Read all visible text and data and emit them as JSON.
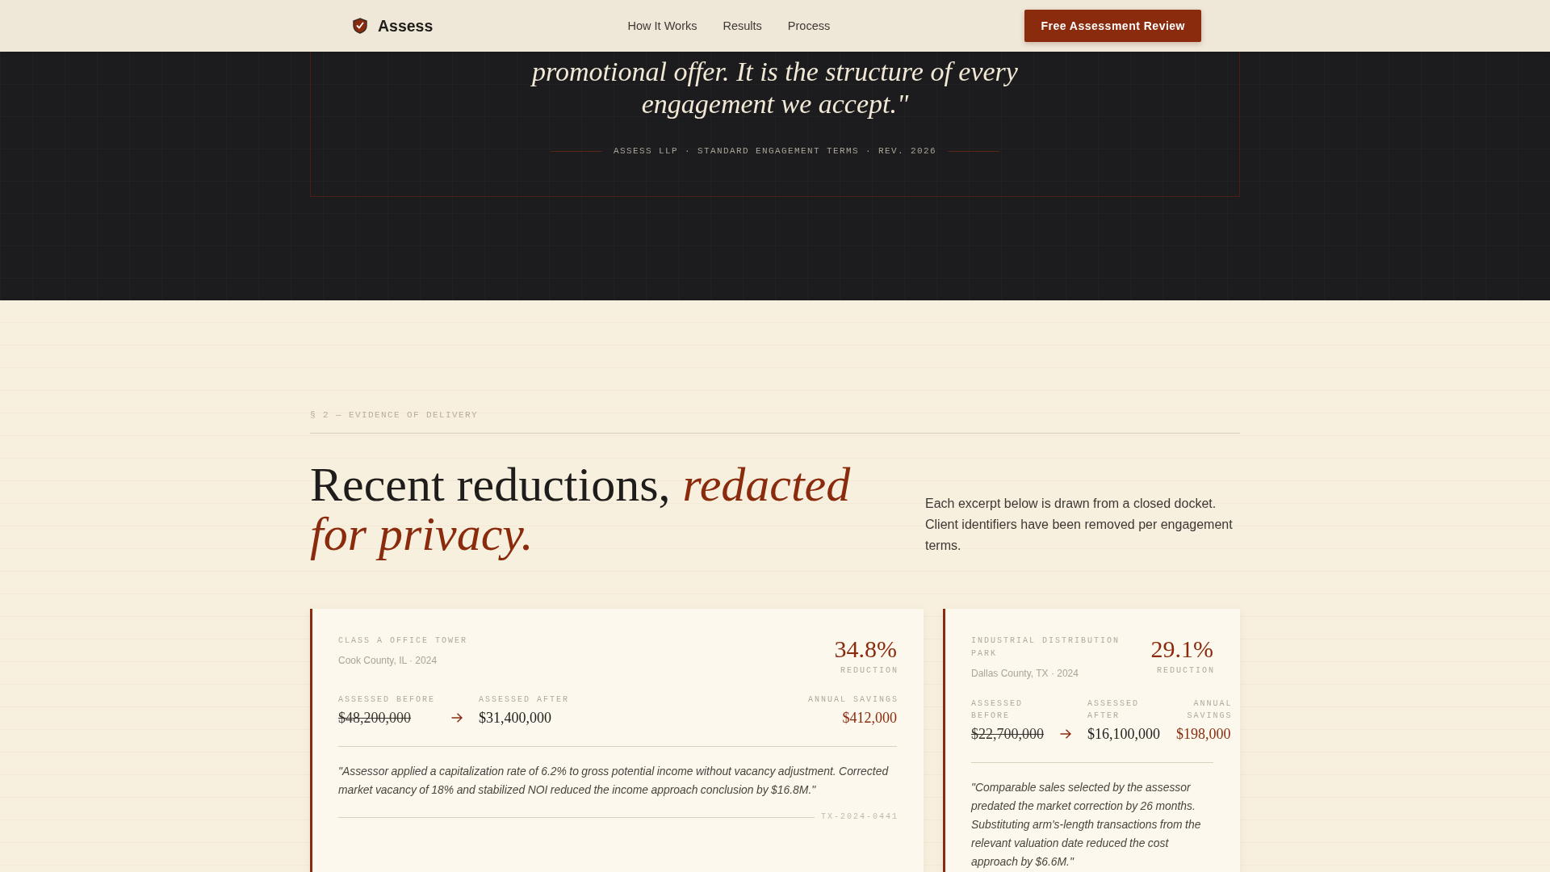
{
  "nav": {
    "brand": "Assess",
    "links": [
      "How It Works",
      "Results",
      "Process"
    ],
    "cta": "Free Assessment Review"
  },
  "commitment": {
    "quote": "promotional offer. It is the structure of every engagement we accept.\"",
    "attribution": "ASSESS LLP · STANDARD ENGAGEMENT TERMS · REV. 2026"
  },
  "evidence": {
    "eyebrow": "§ 2 — EVIDENCE OF DELIVERY",
    "heading": "Recent reductions, *redacted for privacy.*",
    "intro": "Each excerpt below is drawn from a closed docket. Client identifiers have been removed per engagement terms.",
    "cases": [
      {
        "property_type": "CLASS A OFFICE TOWER",
        "location": "Cook County, IL · 2024",
        "reduction": "34.8%",
        "reduction_label": "REDUCTION",
        "metrics": [
          {
            "kind": "before",
            "label": "ASSESSED BEFORE",
            "value": "$48,200,000"
          },
          {
            "kind": "after",
            "label": "ASSESSED AFTER",
            "value": "$31,400,000"
          },
          {
            "kind": "savings",
            "label": "ANNUAL SAVINGS",
            "value": "$412,000"
          }
        ],
        "summary": "\"Assessor applied a capitalization rate of 6.2% to gross potential income without vacancy adjustment. Corrected market vacancy of 18% and stabilized NOI reduced the income approach conclusion by $16.8M.\"",
        "docket": "TX-2024-0441"
      },
      {
        "property_type": "INDUSTRIAL DISTRIBUTION PARK",
        "location": "Dallas County, TX · 2024",
        "reduction": "29.1%",
        "reduction_label": "REDUCTION",
        "metrics": [
          {
            "kind": "before",
            "label": "ASSESSED BEFORE",
            "value": "$22,700,000"
          },
          {
            "kind": "after",
            "label": "ASSESSED AFTER",
            "value": "$16,100,000"
          },
          {
            "kind": "savings",
            "label": "ANNUAL SAVINGS",
            "value": "$198,000"
          }
        ],
        "summary": "\"Comparable sales selected by the assessor predated the market correction by 26 months. Substituting arm's-length transactions from the relevant valuation date reduced the cost approach by $6.6M.\""
      }
    ]
  }
}
